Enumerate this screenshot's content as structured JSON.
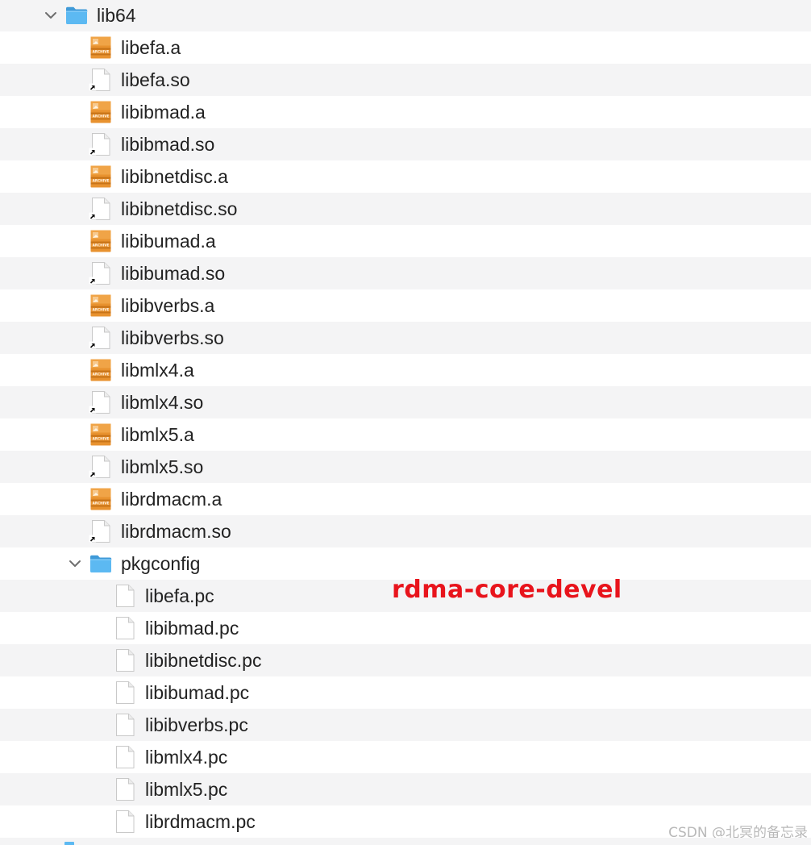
{
  "rows": [
    {
      "kind": "folder",
      "level": 0,
      "expanded": true,
      "name": "lib64"
    },
    {
      "kind": "archive",
      "level": 1,
      "name": "libefa.a"
    },
    {
      "kind": "symlink",
      "level": 1,
      "name": "libefa.so"
    },
    {
      "kind": "archive",
      "level": 1,
      "name": "libibmad.a"
    },
    {
      "kind": "symlink",
      "level": 1,
      "name": "libibmad.so"
    },
    {
      "kind": "archive",
      "level": 1,
      "name": "libibnetdisc.a"
    },
    {
      "kind": "symlink",
      "level": 1,
      "name": "libibnetdisc.so"
    },
    {
      "kind": "archive",
      "level": 1,
      "name": "libibumad.a"
    },
    {
      "kind": "symlink",
      "level": 1,
      "name": "libibumad.so"
    },
    {
      "kind": "archive",
      "level": 1,
      "name": "libibverbs.a"
    },
    {
      "kind": "symlink",
      "level": 1,
      "name": "libibverbs.so"
    },
    {
      "kind": "archive",
      "level": 1,
      "name": "libmlx4.a"
    },
    {
      "kind": "symlink",
      "level": 1,
      "name": "libmlx4.so"
    },
    {
      "kind": "archive",
      "level": 1,
      "name": "libmlx5.a"
    },
    {
      "kind": "symlink",
      "level": 1,
      "name": "libmlx5.so"
    },
    {
      "kind": "archive",
      "level": 1,
      "name": "librdmacm.a"
    },
    {
      "kind": "symlink",
      "level": 1,
      "name": "librdmacm.so"
    },
    {
      "kind": "folder",
      "level": 1,
      "expanded": true,
      "name": "pkgconfig"
    },
    {
      "kind": "file",
      "level": 2,
      "name": "libefa.pc"
    },
    {
      "kind": "file",
      "level": 2,
      "name": "libibmad.pc"
    },
    {
      "kind": "file",
      "level": 2,
      "name": "libibnetdisc.pc"
    },
    {
      "kind": "file",
      "level": 2,
      "name": "libibumad.pc"
    },
    {
      "kind": "file",
      "level": 2,
      "name": "libibverbs.pc"
    },
    {
      "kind": "file",
      "level": 2,
      "name": "libmlx4.pc"
    },
    {
      "kind": "file",
      "level": 2,
      "name": "libmlx5.pc"
    },
    {
      "kind": "file",
      "level": 2,
      "name": "librdmacm.pc"
    }
  ],
  "icons": {
    "folder": "folder-icon",
    "archive": "archive-icon",
    "archive_label": "ARCHIVE",
    "symlink": "alias-document-icon",
    "file": "document-icon",
    "chevron": "chevron-down-icon"
  },
  "colors": {
    "row_stripe": "#f4f4f5",
    "folder_blue": "#5cb9f2",
    "archive_orange": "#e8922f",
    "annotation_red": "#e8141c"
  },
  "annotation": "rdma-core-devel",
  "watermark": "CSDN @北冥的备忘录"
}
